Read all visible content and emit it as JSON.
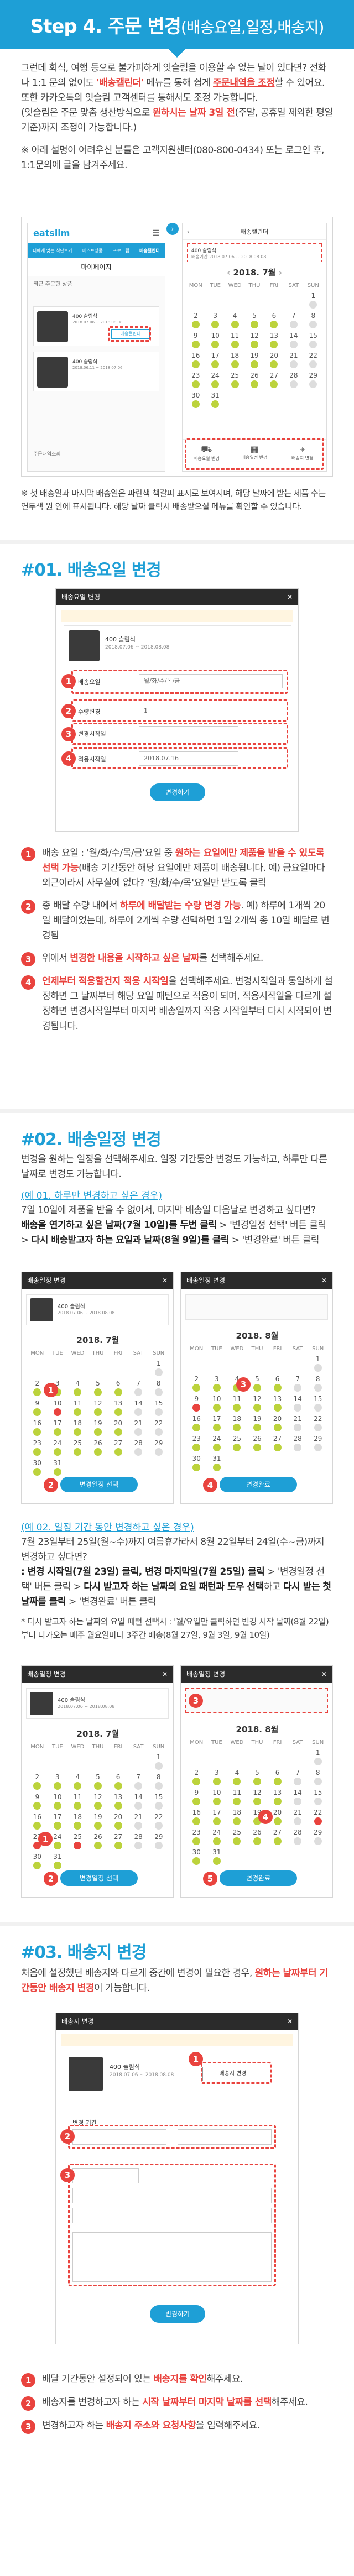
{
  "banner": {
    "title": "Step 4. 주문 변경",
    "title_sub": "(배송요일,일정,배송지)"
  },
  "intro": {
    "p1a": "그런데 회식, 여행 등으로 불가피하게 잇슬림을 이용할 수 없는 날이 있다면? 전화나 1:1 문의 없이도 ",
    "p1b": "'배송캘린더'",
    "p1c": " 메뉴를 통해 쉽게 ",
    "p1d": "주문내역을 조정",
    "p1e": "할 수 있어요. 또한 카카오톡의 잇슬림 고객센터를 통해서도 조정 가능합니다.",
    "p2a": "(잇슬림은 주문 맞춤 생산방식으로 ",
    "p2b": "원하시는 날짜 3일 전",
    "p2c": "(주말, 공휴일 제외한 평일 기준)까지 조정이 가능합니다.)",
    "p3": "※ 아래 설명이 어려우신 분들은 고객지원센터(080-800-0434) 또는 로그인 후, 1:1문의에 글을 남겨주세요."
  },
  "shot1": {
    "logo": "eatslim",
    "menu": [
      "나에게 맞는 식단보기",
      "베스트상품",
      "프로그램",
      "배송캘린더"
    ],
    "page_title": "마이페이지",
    "section": "최근 주문한 상품",
    "item1": "400 슬림식",
    "item1_date": "2018.07.06 ~ 2018.08.08",
    "item1_btn": "배송캘린더",
    "item2": "400 슬림식",
    "item2_date": "2018.06.11 ~ 2018.07.06",
    "footer": "주문내역조회",
    "right_title": "배송캘린더",
    "right_item": "400 슬림식",
    "right_period": "배송기간",
    "right_dates": "2018.07.06 ~ 2018.08.08",
    "month": "2018. 7월",
    "dow": [
      "MON",
      "TUE",
      "WED",
      "THU",
      "FRI",
      "SAT",
      "SUN"
    ],
    "days": [
      "",
      "",
      "",
      "",
      "",
      "",
      "1",
      "2",
      "3",
      "4",
      "5",
      "6",
      "7",
      "8",
      "9",
      "10",
      "11",
      "12",
      "13",
      "14",
      "15",
      "16",
      "17",
      "18",
      "19",
      "20",
      "21",
      "22",
      "23",
      "24",
      "25",
      "26",
      "27",
      "28",
      "29",
      "30",
      "31",
      "",
      "",
      "",
      "",
      ""
    ],
    "dots": [
      0,
      0,
      0,
      0,
      0,
      0,
      0,
      1,
      1,
      1,
      1,
      1,
      0,
      0,
      1,
      1,
      1,
      1,
      1,
      0,
      0,
      1,
      1,
      1,
      1,
      1,
      0,
      0,
      1,
      1,
      1,
      1,
      1,
      0,
      0,
      1,
      1,
      0,
      0,
      0,
      0,
      0
    ],
    "tabs": [
      "배송요일 변경",
      "배송일정 변경",
      "배송지 변경"
    ]
  },
  "note1a": "※ 첫 배송일과 마지막 배송일은 파란색 책갈피 표시로 보여지며, 해당 날짜에 받는 제품 수는 연두색 원 안에 표시됩니다. 해당 날짜 클릭시 배송받으실 메뉴를 확인할 수 있습니다.",
  "sec1": {
    "title": "#01. 배송요일 변경",
    "modal": "배송요일 변경",
    "item": "400 슬림식",
    "item_date": "2018.07.06 ~ 2018.08.08",
    "f1": "배송요일",
    "f1v": "월/화/수/목/금",
    "f2": "수량변경",
    "f2v": "1",
    "f3": "적용시작일",
    "f3v": "2018.07.16",
    "btn": "변경하기",
    "items": [
      {
        "n": "1",
        "a": "배송 요일 : '월/화/수/목/금'요일 중 ",
        "b": "원하는 요일에만 제품을 받을 수 있도록 선택 가능",
        "c": "(배송 기간동안 해당 요일에만 제품이 배송됩니다. 예) 금요일마다 외근이라서 사무실에 없다? '월/화/수/목'요일만 받도록 클릭"
      },
      {
        "n": "2",
        "a": "총 배달 수량 내에서 ",
        "b": "하루에 배달받는 수량 변경 가능",
        "c": ". 예) 하루에 1개씩 20일 배달이었는데, 하루에 2개씩 수량 선택하면 1일 2개씩 총 10일 배달로 변경됨"
      },
      {
        "n": "3",
        "a": "위에서 ",
        "b": "변경한 내용을 시작하고 싶은 날짜",
        "c": "를 선택해주세요."
      },
      {
        "n": "4",
        "a": "",
        "b": "언제부터 적용할건지 적용 시작일",
        "c": "을 선택해주세요. 변경시작일과 동일하게 설정하면 그 날짜부터 해당 요일 패턴으로 적용이 되며, 적용시작일을 다르게 설정하면 변경시작일부터 마지막 배송일까지 적용 시작일부터 다시 시작되어 변경됩니다."
      }
    ]
  },
  "sec2": {
    "title": "#02. 배송일정 변경",
    "desc": "변경을 원하는 일정을 선택해주세요. 일정 기간동안 변경도 가능하고, 하루만 다른 날짜로 변경도 가능합니다.",
    "ex1": "(예 01. 하루만 변경하고 싶은 경우)",
    "ex1_p1": "7일 10일에 제품을 받을 수 없어서, 마지막 배송일 다음날로 변경하고 싶다면?",
    "ex1_p2": "배송을 연기하고 싶은 날짜(7월 10일)를 두번 클릭",
    "ex1_p3": " > '변경일정 선택' 버튼 클릭 > ",
    "ex1_p4": "다시 배송받고자 하는 요일과 날짜(8월 9일)를 클릭",
    "ex1_p5": " > '변경완료' 버튼 클릭",
    "ex2": "(예 02. 일정 기간 동안 변경하고 싶은 경우)",
    "ex2_p1": "7월 23일부터 25일(월~수)까지 여름휴가라서 8월 22일부터 24일(수~금)까지 변경하고 싶다면?",
    "ex2_p2": ": 변경 시작일(7월 23일) 클릭, 변경 마지막일(7월 25일) 클릭",
    "ex2_p3": " > '변경일정 선택' 버튼 클릭 > ",
    "ex2_p4": "다시 받고자 하는 날짜의 요일 패턴과 도우 선택",
    "ex2_p5": "하고 ",
    "ex2_p6": "다시 받는 첫 날짜를 클릭",
    "ex2_p7": " > '변경완료' 버튼 클릭",
    "ex2_note": "* 다시 받고자 하는 날짜의 요일 패턴 선택시 : '월/요일만 클릭하면 변경 시작 날짜(8월 22일)부터 다가오는 매주 월요일마다 3주간 배송(8월 27일, 9월 3일, 9월 10일)",
    "modal": "배송일정 변경",
    "item": "400 슬림식",
    "item_date": "2018.07.06 ~ 2018.08.08",
    "month": "2018. 7월",
    "month2": "2018. 8월"
  },
  "sec3": {
    "title": "#03. 배송지 변경",
    "p1": "처음에 설정했던 배송지와 다르게 중간에 변경이 필요한 경우, ",
    "p2": "원하는 날짜부터 기간동안 배송지 변경",
    "p3": "이 가능합니다.",
    "modal": "배송지 변경",
    "item": "400 슬림식",
    "item_date": "2018.07.06 ~ 2018.08.08",
    "btn_addr": "배송지 변경",
    "btn": "변경하기",
    "items": [
      {
        "n": "1",
        "a": "배달 기간동안 설정되어 있는 ",
        "b": "배송지를 확인",
        "c": "해주세요."
      },
      {
        "n": "2",
        "a": "배송지를 변경하고자 하는 ",
        "b": "시작 날짜부터 마지막 날짜를 선택",
        "c": "해주세요."
      },
      {
        "n": "3",
        "a": "변경하고자 하는 ",
        "b": "배송지 주소와 요청사항",
        "c": "을 입력해주세요."
      }
    ]
  },
  "colors": {
    "accent": "#1e9fd6",
    "red": "#e9433e",
    "green": "#bcd33c"
  }
}
